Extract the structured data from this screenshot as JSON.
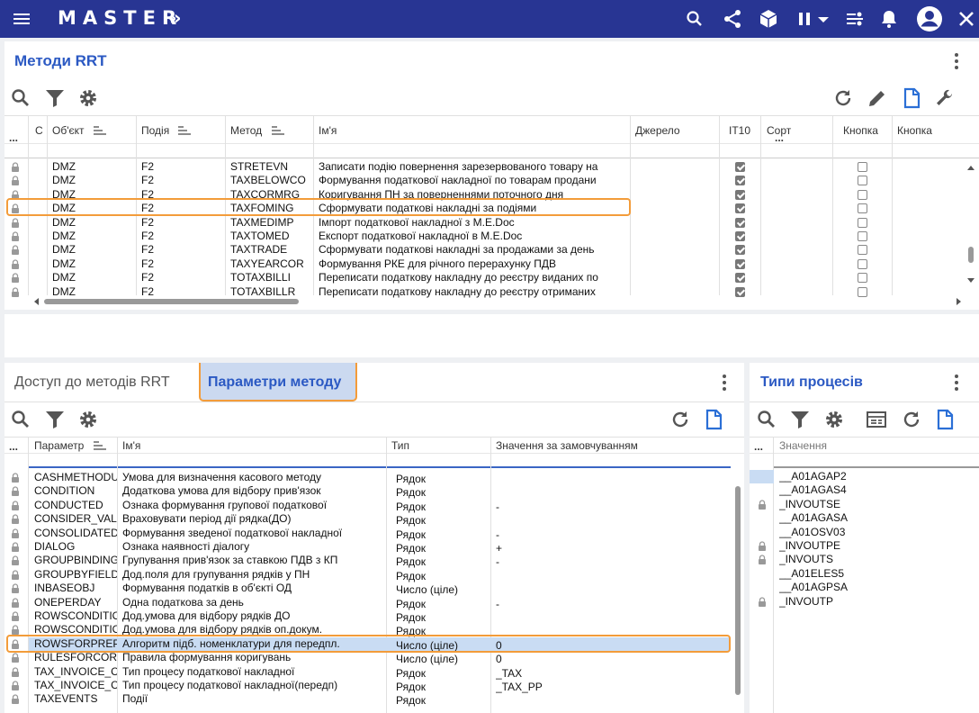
{
  "app": {
    "title": "MASTER",
    "title_arrows": "»"
  },
  "topbar_icons": [
    "menu-icon",
    "search-icon",
    "share-icon",
    "cube-icon",
    "pause-icon",
    "chevron-down-icon",
    "list-settings-icon",
    "bell-icon",
    "account-icon",
    "close-icon"
  ],
  "methods_panel": {
    "title": "Методи RRT",
    "columns": {
      "c": "C",
      "object": "Об'єкт",
      "event": "Подія",
      "method": "Метод",
      "name": "Ім'я",
      "source": "Джерело",
      "it10": "IT10",
      "sort": "Сорт",
      "button1": "Кнопка",
      "button2": "Кнопка"
    },
    "menu_dots": "...",
    "rows": [
      {
        "object": "DMZ",
        "event": "F2",
        "method": "STRETEVN",
        "name": "Записати подію повернення зарезервованого товару на",
        "it10": true,
        "button": false
      },
      {
        "object": "DMZ",
        "event": "F2",
        "method": "TAXBELOWCO",
        "name": "Формування податкової накладної по товарам продани",
        "it10": true,
        "button": false
      },
      {
        "object": "DMZ",
        "event": "F2",
        "method": "TAXCORMRG",
        "name": "Коригування ПН за поверненнями поточного дня",
        "it10": true,
        "button": false
      },
      {
        "object": "DMZ",
        "event": "F2",
        "method": "TAXFOMING",
        "name": "Сформувати податкові накладні за подіями",
        "it10": true,
        "button": false
      },
      {
        "object": "DMZ",
        "event": "F2",
        "method": "TAXMEDIMP",
        "name": "Імпорт податкової накладної з M.E.Doc",
        "it10": true,
        "button": false
      },
      {
        "object": "DMZ",
        "event": "F2",
        "method": "TAXTOMED",
        "name": "Експорт податкової накладної в M.E.Doc",
        "it10": true,
        "button": false
      },
      {
        "object": "DMZ",
        "event": "F2",
        "method": "TAXTRADE",
        "name": "Сформувати податкові накладні за продажами за день",
        "it10": true,
        "button": false
      },
      {
        "object": "DMZ",
        "event": "F2",
        "method": "TAXYEARCOR",
        "name": "Формування РКЕ для річного перерахунку ПДВ",
        "it10": true,
        "button": false
      },
      {
        "object": "DMZ",
        "event": "F2",
        "method": "TOTAXBILLI",
        "name": "Переписати податкову накладну до реєстру виданих по",
        "it10": true,
        "button": false
      },
      {
        "object": "DMZ",
        "event": "F2",
        "method": "TOTAXBILLR",
        "name": "Переписати податкову накладну до реєстру отриманих",
        "it10": true,
        "button": false
      }
    ]
  },
  "params_panel": {
    "tab_access": "Доступ до методів RRT",
    "tab_params": "Параметри методу",
    "columns": {
      "param": "Параметр",
      "name": "Ім'я",
      "type": "Тип",
      "default": "Значення за замовчуванням"
    },
    "menu_dots": "...",
    "rows": [
      {
        "param": "CASHMETHODU",
        "name": "Умова для визначення касового методу",
        "type": "Рядок",
        "default": ""
      },
      {
        "param": "CONDITION",
        "name": "Додаткова умова для відбору прив'язок",
        "type": "Рядок",
        "default": ""
      },
      {
        "param": "CONDUCTED",
        "name": "Ознака формування групової податкової",
        "type": "Рядок",
        "default": "-"
      },
      {
        "param": "CONSIDER_VAL",
        "name": "Враховувати період дії рядка(ДО)",
        "type": "Рядок",
        "default": ""
      },
      {
        "param": "CONSOLIDATED",
        "name": "Формування зведеної податкової накладної",
        "type": "Рядок",
        "default": "-"
      },
      {
        "param": "DIALOG",
        "name": "Ознака наявності діалогу",
        "type": "Рядок",
        "default": "+"
      },
      {
        "param": "GROUPBINDING",
        "name": "Групування прив'язок за ставкою ПДВ з КП",
        "type": "Рядок",
        "default": "-"
      },
      {
        "param": "GROUPBYFIELD",
        "name": "Дод.поля для групування рядків у ПН",
        "type": "Рядок",
        "default": ""
      },
      {
        "param": "INBASEOBJ",
        "name": "Формування податків в об'єкті ОД",
        "type": "Число (ціле)",
        "default": ""
      },
      {
        "param": "ONEPERDAY",
        "name": "Одна податкова за день",
        "type": "Рядок",
        "default": "-"
      },
      {
        "param": "ROWSCONDITIO",
        "name": "Дод.умова для відбору рядків ДО",
        "type": "Рядок",
        "default": ""
      },
      {
        "param": "ROWSCONDITIO",
        "name": "Дод.умова для відбору рядків оп.докум.",
        "type": "Рядок",
        "default": ""
      },
      {
        "param": "ROWSFORPREP",
        "name": "Алгоритм підб. номенклатури для передпл.",
        "type": "Число (ціле)",
        "default": "0"
      },
      {
        "param": "RULESFORCORI",
        "name": "Правила формування коригувань",
        "type": "Число (ціле)",
        "default": "0"
      },
      {
        "param": "TAX_INVOICE_C",
        "name": "Тип процесу податкової накладної",
        "type": "Рядок",
        "default": "_TAX"
      },
      {
        "param": "TAX_INVOICE_C",
        "name": "Тип процесу податкової накладної(передп)",
        "type": "Рядок",
        "default": "_TAX_PP"
      },
      {
        "param": "TAXEVENTS",
        "name": "Події",
        "type": "Рядок",
        "default": ""
      }
    ]
  },
  "types_panel": {
    "title": "Типи процесів",
    "columns": {
      "value": "Значення"
    },
    "menu_dots": "...",
    "rows": [
      {
        "value": "__A01AGAP2",
        "locked": false
      },
      {
        "value": "__A01AGAS4",
        "locked": false
      },
      {
        "value": "_INVOUTSE",
        "locked": true
      },
      {
        "value": "__A01AGASA",
        "locked": false
      },
      {
        "value": "__A01OSV03",
        "locked": false
      },
      {
        "value": "_INVOUTPE",
        "locked": true
      },
      {
        "value": "_INVOUTS",
        "locked": true
      },
      {
        "value": "__A01ELES5",
        "locked": false
      },
      {
        "value": "__A01AGPSA",
        "locked": false
      },
      {
        "value": "_INVOUTP",
        "locked": true
      }
    ]
  },
  "colors": {
    "topbar": "#283593",
    "accent": "#2b59c3",
    "highlight": "#f39c3a",
    "selected_row": "#c9dcf3"
  }
}
